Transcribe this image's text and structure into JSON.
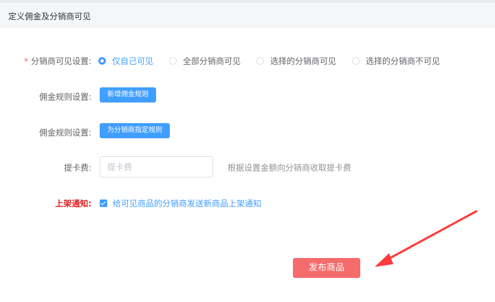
{
  "header": {
    "title": "定义佣金及分销商可见"
  },
  "visibility": {
    "label": "分销商可见设置:",
    "required_mark": "*",
    "options": [
      {
        "label": "仅自己可见",
        "checked": true
      },
      {
        "label": "全部分销商可见",
        "checked": false
      },
      {
        "label": "选择的分销商可见",
        "checked": false
      },
      {
        "label": "选择的分销商不可见",
        "checked": false
      }
    ]
  },
  "commission_rule_1": {
    "label": "佣金规则设置:",
    "button": "新增佣金规则"
  },
  "commission_rule_2": {
    "label": "佣金规则设置:",
    "button": "为分销商指定规则"
  },
  "card_fee": {
    "label": "提卡费:",
    "placeholder": "提卡费",
    "value": "",
    "hint": "根据设置金额向分销商收取提卡费"
  },
  "listing_notice": {
    "label": "上架通知:",
    "checkbox_label": "给可见商品的分销商发送新商品上架通知",
    "checked": true
  },
  "publish_button": "发布商品",
  "colors": {
    "primary": "#409eff",
    "danger": "#f56c6c",
    "annotation_arrow": "#ff3a3a",
    "label_red": "#e02020"
  }
}
